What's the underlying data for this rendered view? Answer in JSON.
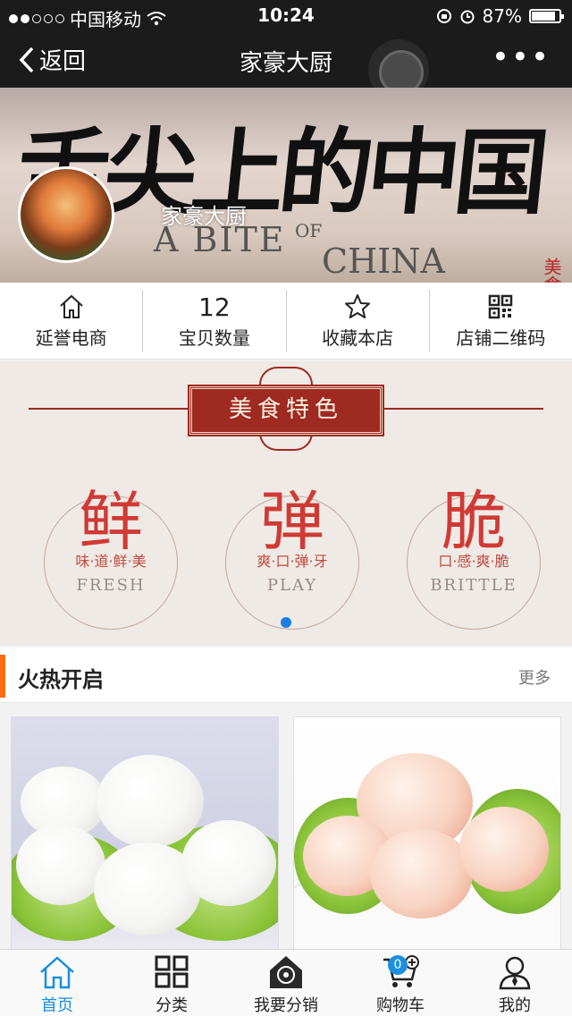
{
  "status_bar": {
    "carrier": "中国移动",
    "time": "10:24",
    "battery": "87%",
    "battery_level": 0.87
  },
  "nav": {
    "back_label": "返回",
    "title": "家豪大厨",
    "more": "•••"
  },
  "banner": {
    "calligraphy": "舌尖上的中国",
    "subtitle_1": "A BITE",
    "subtitle_of": "OF",
    "subtitle_2": "CHINA",
    "seal": "美食",
    "shop_name": "家豪大厨"
  },
  "shop_info": [
    {
      "top": "",
      "icon": "home-icon",
      "label": "延誉电商"
    },
    {
      "top": "12",
      "icon": "",
      "label": "宝贝数量"
    },
    {
      "top": "",
      "icon": "star-icon",
      "label": "收藏本店"
    },
    {
      "top": "",
      "icon": "qr-code-icon",
      "label": "店铺二维码"
    }
  ],
  "features": {
    "title": "美食特色",
    "items": [
      {
        "big": "鲜",
        "desc": "味·道·鲜·美",
        "en": "FRESH"
      },
      {
        "big": "弹",
        "desc": "爽·口·弹·牙",
        "en": "PLAY"
      },
      {
        "big": "脆",
        "desc": "口·感·爽·脆",
        "en": "BRITTLE"
      }
    ],
    "active_dot": 0
  },
  "section": {
    "title": "火热开启",
    "more": "更多"
  },
  "products": [
    {
      "name": "fish-ball-product",
      "kind": "fish-ball"
    },
    {
      "name": "shrimp-ball-product",
      "kind": "shrimp-ball"
    }
  ],
  "tabs": [
    {
      "label": "首页",
      "icon": "home-icon",
      "active": true
    },
    {
      "label": "分类",
      "icon": "grid-icon",
      "active": false
    },
    {
      "label": "我要分销",
      "icon": "distribution-icon",
      "active": false
    },
    {
      "label": "购物车",
      "icon": "cart-icon",
      "active": false,
      "count": "0"
    },
    {
      "label": "我的",
      "icon": "user-icon",
      "active": false
    }
  ],
  "colors": {
    "accent": "#1a8fe0",
    "section_bar": "#ff6a13",
    "feature_red": "#d03a35",
    "title_bg": "#9e2a22"
  }
}
